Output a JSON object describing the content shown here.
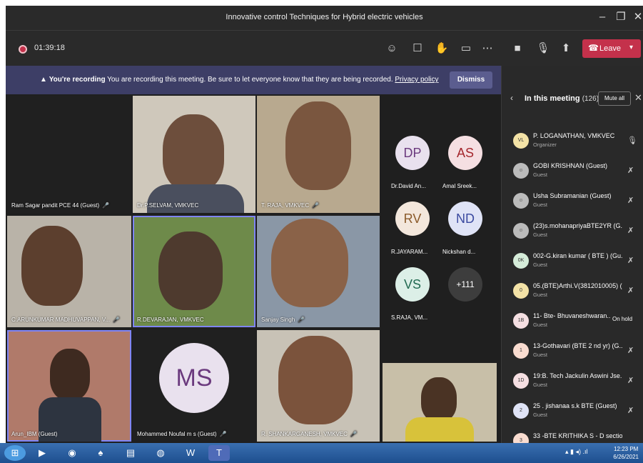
{
  "window": {
    "title": "Innovative control Techniques for Hybrid electric vehicles"
  },
  "toolbar": {
    "timer": "01:39:18",
    "leave_label": "Leave"
  },
  "banner": {
    "bold_text": "You're recording",
    "message": "You are recording this meeting. Be sure to let everyone know that they are being recorded.",
    "link": "Privacy policy",
    "dismiss_label": "Dismiss"
  },
  "tiles": [
    {
      "name": "Ram Sagar pandit PCE 44 (Guest)"
    },
    {
      "name": "Dr.P.SELVAM, VMKVEC"
    },
    {
      "name": "T. RAJA, VMKVEC"
    },
    {
      "name": "C.ARUNKUMAR MADHUVAPPAN, V..."
    },
    {
      "name": "R.DEVARAJAN, VMKVEC"
    },
    {
      "name": "Sanjay Singh"
    },
    {
      "name": "Arun_IBM (Guest)"
    },
    {
      "name": "Mohammed Noufal m s (Guest)",
      "initials": "MS"
    },
    {
      "name": "R. SHANKARGANESH, VMKVEC"
    }
  ],
  "avatars": [
    {
      "initials": "DP",
      "label": "Dr.David An..."
    },
    {
      "initials": "AS",
      "label": "Amal Sreek..."
    },
    {
      "initials": "RV",
      "label": "R.JAYARAM..."
    },
    {
      "initials": "ND",
      "label": "Nickshan d..."
    },
    {
      "initials": "VS",
      "label": "S.RAJA, VM..."
    },
    {
      "initials": "+111",
      "label": ""
    }
  ],
  "panel": {
    "title": "In this meeting",
    "count": "(126)",
    "mute_all": "Mute all",
    "participants": [
      {
        "initials": "VL",
        "name": "P. LOGANATHAN, VMKVEC",
        "role": "Organizer"
      },
      {
        "initials": "",
        "name": "GOBI KRISHNAN (Guest)",
        "role": "Guest"
      },
      {
        "initials": "",
        "name": "Usha Subramanian (Guest)",
        "role": "Guest"
      },
      {
        "initials": "",
        "name": "(23)s.mohanapriyaBTE2YR (G...",
        "role": "Guest"
      },
      {
        "initials": "0K",
        "name": "002-G.kiran kumar ( BTE ) (Gu...",
        "role": "Guest"
      },
      {
        "initials": "0",
        "name": "05.(BTE)Arthi.V(3812010005) (...",
        "role": "Guest"
      },
      {
        "initials": "1B",
        "name": "11- Bte- Bhuvaneshwaran....",
        "role": "Guest",
        "status": "On hold"
      },
      {
        "initials": "1",
        "name": "13-Gothavari (BTE 2 nd yr) (G...",
        "role": "Guest"
      },
      {
        "initials": "1D",
        "name": "19:B. Tech Jackulin Aswini Jse...",
        "role": "Guest"
      },
      {
        "initials": "2",
        "name": "25 . jishanaa s.k BTE (Guest)",
        "role": "Guest"
      },
      {
        "initials": "3",
        "name": "33 -BTE KRITHIKA S - D sectio...",
        "role": ""
      }
    ]
  },
  "taskbar": {
    "time": "12:23 PM",
    "date": "6/26/2021"
  },
  "colors": {
    "accent": "#6264a7",
    "leave": "#c4314b",
    "banner": "#3d3e66"
  }
}
